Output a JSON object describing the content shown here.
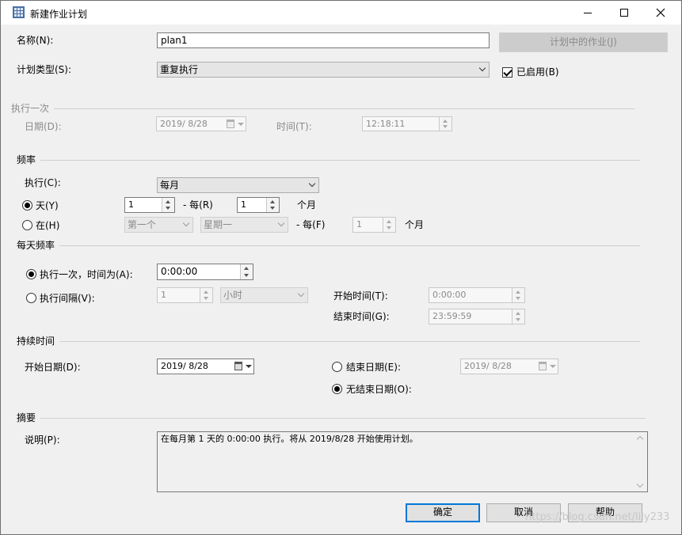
{
  "window": {
    "title": "新建作业计划"
  },
  "name_row": {
    "label": "名称(N):",
    "value": "plan1",
    "jobs_button": "计划中的作业(J)"
  },
  "schedule_type": {
    "label": "计划类型(S):",
    "value": "重复执行",
    "enabled_label": "已启用(B)",
    "enabled": true
  },
  "one_time": {
    "section": "执行一次",
    "date_label": "日期(D):",
    "date_value": "2019/ 8/28",
    "time_label": "时间(T):",
    "time_value": "12:18:11"
  },
  "frequency": {
    "section": "频率",
    "execute_label": "执行(C):",
    "execute_value": "每月",
    "day_label": "天(Y)",
    "day_value": "1",
    "every_label": "- 每(R)",
    "every_value": "1",
    "month_unit": "个月",
    "on_label": "在(H)",
    "on_week_value": "第一个",
    "on_day_value": "星期一",
    "on_every_label": "- 每(F)",
    "on_every_value": "1",
    "on_month_unit": "个月"
  },
  "daily": {
    "section": "每天频率",
    "once_label": "执行一次，时间为(A):",
    "once_value": "0:00:00",
    "interval_label": "执行间隔(V):",
    "interval_value": "1",
    "interval_unit": "小时",
    "start_label": "开始时间(T):",
    "start_value": "0:00:00",
    "end_label": "结束时间(G):",
    "end_value": "23:59:59"
  },
  "duration": {
    "section": "持续时间",
    "start_label": "开始日期(D):",
    "start_value": "2019/ 8/28",
    "end_label": "结束日期(E):",
    "end_value": "2019/ 8/28",
    "no_end_label": "无结束日期(O):"
  },
  "summary": {
    "section": "摘要",
    "desc_label": "说明(P):",
    "text": "在每月第 1 天的 0:00:00 执行。将从 2019/8/28 开始使用计划。"
  },
  "buttons": {
    "ok": "确定",
    "cancel": "取消",
    "help": "帮助"
  },
  "watermark": "https://blog.csdn.net/lily233"
}
